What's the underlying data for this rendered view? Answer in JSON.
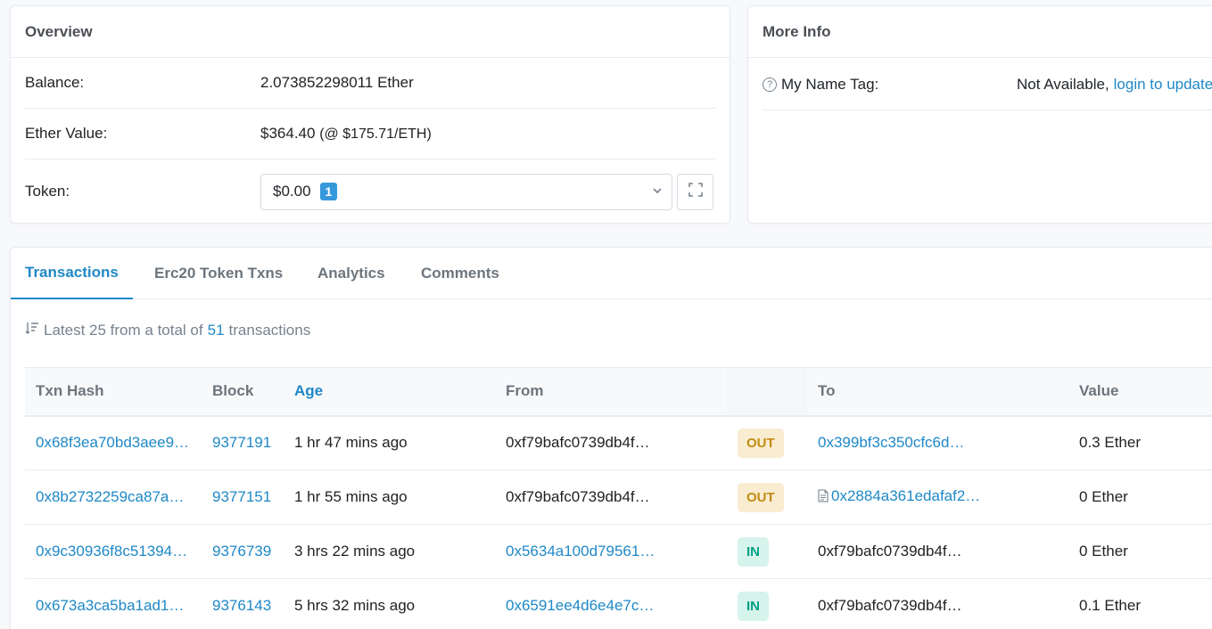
{
  "overview": {
    "title": "Overview",
    "balance_label": "Balance:",
    "balance_value": "2.073852298011 Ether",
    "ether_value_label": "Ether Value:",
    "ether_value": "$364.40",
    "ether_price": "(@ $175.71/ETH)",
    "token_label": "Token:",
    "token_value": "$0.00",
    "token_count": "1"
  },
  "more_info": {
    "title": "More Info",
    "name_tag_label": "My Name Tag:",
    "name_tag_value": "Not Available,",
    "login_link": "login to update"
  },
  "tabs": [
    {
      "label": "Transactions",
      "active": true
    },
    {
      "label": "Erc20 Token Txns",
      "active": false
    },
    {
      "label": "Analytics",
      "active": false
    },
    {
      "label": "Comments",
      "active": false
    }
  ],
  "summary": {
    "prefix": "Latest 25 from a total of",
    "total": "51",
    "suffix": "transactions"
  },
  "table": {
    "headers": {
      "txn_hash": "Txn Hash",
      "block": "Block",
      "age": "Age",
      "from": "From",
      "to": "To",
      "value": "Value"
    },
    "rows": [
      {
        "hash": "0x68f3ea70bd3aee9…",
        "block": "9377191",
        "age": "1 hr 47 mins ago",
        "from": "0xf79bafc0739db4f…",
        "dir": "OUT",
        "to": "0x399bf3c350cfc6d…",
        "value": "0.3 Ether"
      },
      {
        "hash": "0x8b2732259ca87a…",
        "block": "9377151",
        "age": "1 hr 55 mins ago",
        "from": "0xf79bafc0739db4f…",
        "dir": "OUT",
        "to": "0x2884a361edafaf2…",
        "value": "0 Ether"
      },
      {
        "hash": "0x9c30936f8c51394…",
        "block": "9376739",
        "age": "3 hrs 22 mins ago",
        "from": "0x5634a100d79561…",
        "dir": "IN",
        "to": "0xf79bafc0739db4f…",
        "value": "0 Ether"
      },
      {
        "hash": "0x673a3ca5ba1ad1…",
        "block": "9376143",
        "age": "5 hrs 32 mins ago",
        "from": "0x6591ee4d6e4e7c…",
        "dir": "IN",
        "to": "0xf79bafc0739db4f…",
        "value": "0.1 Ether"
      }
    ]
  },
  "colors": {
    "link": "#1e88c7",
    "out_bg": "#f9ecd0",
    "out_text": "#c28b12",
    "in_bg": "#d6f3ec",
    "in_text": "#00a186"
  }
}
